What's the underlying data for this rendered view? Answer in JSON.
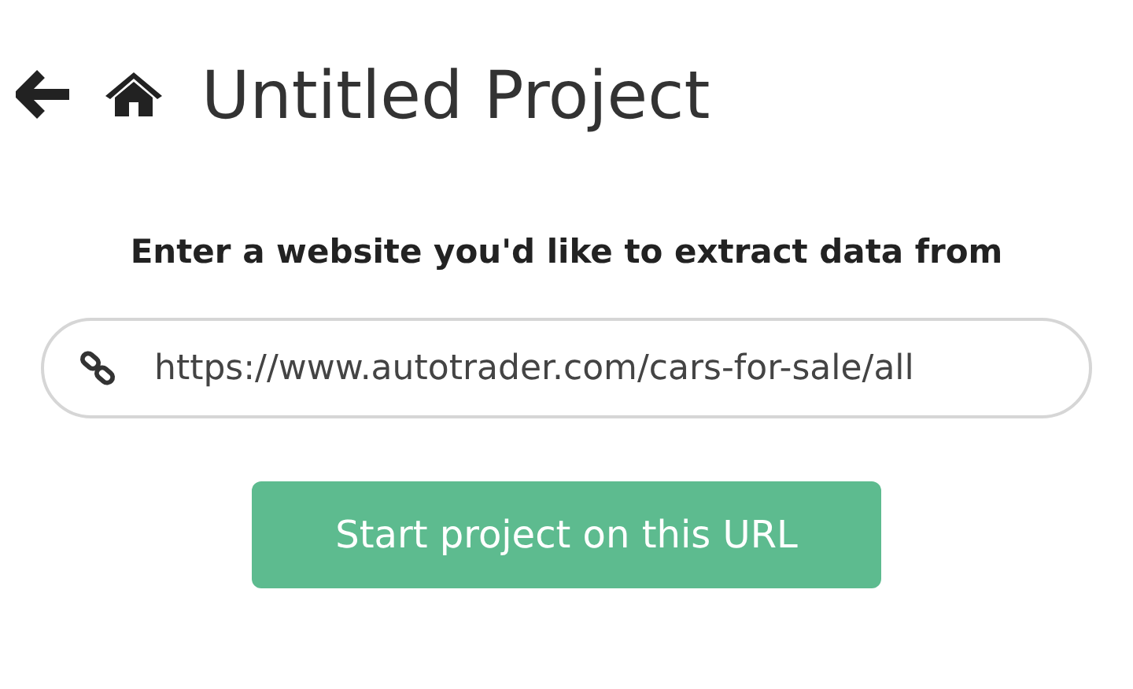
{
  "header": {
    "title": "Untitled Project"
  },
  "prompt": "Enter a website you'd like to extract data from",
  "url_field": {
    "value": "https://www.autotrader.com/cars-for-sale/all"
  },
  "start_button": {
    "label": "Start project on this URL"
  }
}
